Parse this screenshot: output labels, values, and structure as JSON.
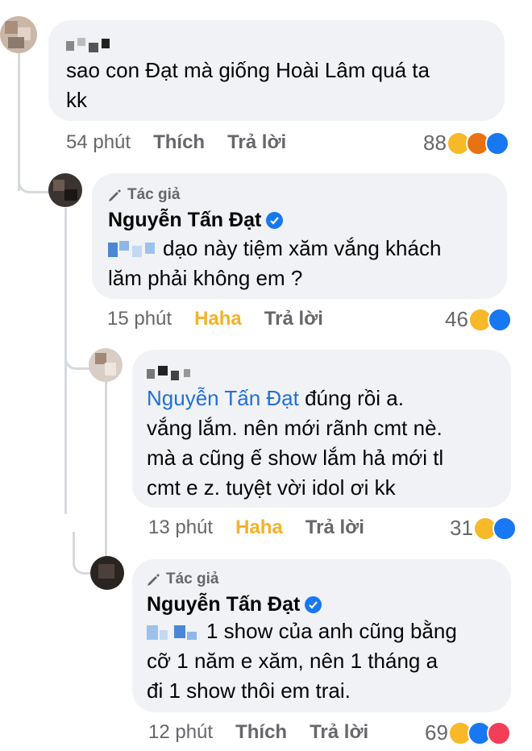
{
  "comments": [
    {
      "id": "c1",
      "author_tag": "",
      "author_name": "",
      "mention": "",
      "text_lines": [
        "sao con Đạt mà giống Hoài Lâm quá ta",
        "kk"
      ],
      "time": "54 phút",
      "action": "Thích",
      "reply": "Trả lời",
      "reaction_count": "88",
      "reaction_icons": [
        "haha-icon",
        "angry-icon",
        "like-icon"
      ]
    },
    {
      "id": "c2",
      "author_tag": "Tác giả",
      "author_name": "Nguyễn Tấn Đạt",
      "text_lines": [
        "dạo này tiệm xăm vắng khách",
        "lăm phải không em ?"
      ],
      "time": "15 phút",
      "action": "Haha",
      "reply": "Trả lời",
      "reaction_count": "46",
      "reaction_icons": [
        "haha-icon",
        "like-icon"
      ]
    },
    {
      "id": "c3",
      "mention": "Nguyễn Tấn Đạt",
      "text_lines": [
        " đúng rồi a.",
        "vắng lắm. nên mới rãnh cmt nè.",
        "mà a cũng ế show lắm hả mới tl",
        "cmt e z. tuyệt vời idol ơi kk"
      ],
      "time": "13 phút",
      "action": "Haha",
      "reply": "Trả lời",
      "reaction_count": "31",
      "reaction_icons": [
        "haha-icon",
        "like-icon"
      ]
    },
    {
      "id": "c4",
      "author_tag": "Tác giả",
      "author_name": "Nguyễn Tấn Đạt",
      "text_lines": [
        "1 show của anh cũng bằng",
        "cỡ 1 năm e xăm, nên 1 tháng a",
        "đi 1 show thôi em trai."
      ],
      "time": "12 phút",
      "action": "Thích",
      "reply": "Trả lời",
      "reaction_count": "69",
      "reaction_icons": [
        "haha-icon",
        "like-icon",
        "love-icon"
      ]
    }
  ],
  "colors": {
    "bubble": "#f0f2f5",
    "meta_text": "#65676b",
    "haha_action": "#f7b125",
    "mention": "#216fdb",
    "verified": "#1877f2"
  },
  "icons": {
    "author_tag": "pencil-icon",
    "verified": "verified-badge-icon"
  }
}
